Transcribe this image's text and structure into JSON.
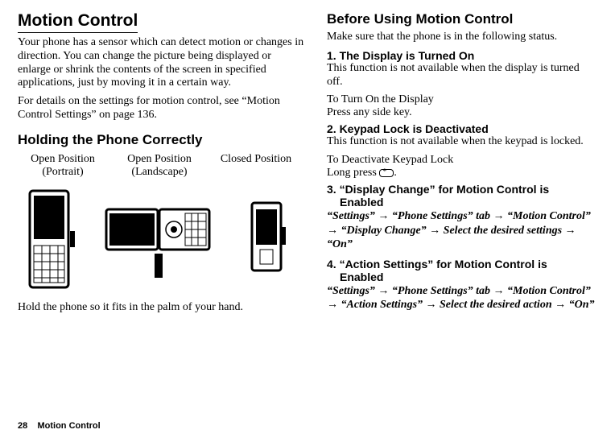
{
  "left": {
    "title": "Motion Control",
    "intro": "Your phone has a sensor which can detect motion or changes in direction. You can change the picture being displayed or enlarge or shrink the contents of the screen in specified applications, just by moving it in a certain way.",
    "detailsRef": "For details on the settings for motion control, see “Motion Control Settings” on page 136.",
    "holdTitle": "Holding the Phone Correctly",
    "labels": {
      "openPortrait1": "Open Position",
      "openPortrait2": "(Portrait)",
      "openLandscape1": "Open Position",
      "openLandscape2": "(Landscape)",
      "closed": "Closed Position"
    },
    "holdCaption": "Hold the phone so it fits in the palm of your hand."
  },
  "right": {
    "title": "Before Using Motion Control",
    "makeSure": "Make sure that the phone is in the following status.",
    "item1": {
      "head": "1. The Display is Turned On",
      "body": "This function is not available when the display is turned off.",
      "subHead": "To Turn On the Display",
      "subBody": "Press any side key."
    },
    "item2": {
      "head": "2. Keypad Lock is Deactivated",
      "body": "This function is not available when the keypad is locked.",
      "subHead": "To Deactivate Keypad Lock",
      "subBody1": "Long press ",
      "subBody2": "."
    },
    "item3": {
      "headL1": "3. “Display Change” for Motion Control is",
      "headL2": "Enabled",
      "path": "“Settings” → “Phone Settings” tab → “Motion Control” → “Display Change” → Select the desired settings → “On”"
    },
    "item4": {
      "headL1": "4. “Action Settings” for Motion Control is",
      "headL2": "Enabled",
      "path": "“Settings” → “Phone Settings” tab → “Motion Control” → “Action Settings” → Select the desired action → “On”"
    }
  },
  "footer": {
    "pageNum": "28",
    "section": "Motion Control"
  }
}
